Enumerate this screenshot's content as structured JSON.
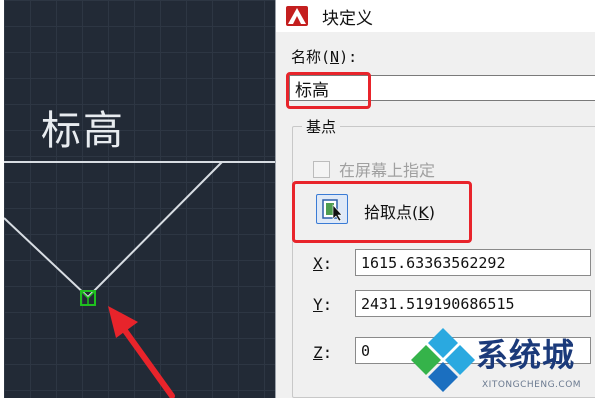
{
  "canvas": {
    "elevation_text": "标高"
  },
  "dialog": {
    "title": "块定义",
    "name_label": "名称(N):",
    "name_value": "标高",
    "base_point": {
      "group_title": "基点",
      "specify_on_screen_label": "在屏幕上指定",
      "specify_on_screen_checked": false,
      "pick_point_label": "拾取点(K)",
      "x_label": "X:",
      "x_value": "1615.63363562292",
      "y_label": "Y:",
      "y_value": "2431.519190686515",
      "z_label": "Z:",
      "z_value": "0"
    }
  },
  "watermark": {
    "text": "系统城",
    "subtext": "XITONGCHENG.COM"
  },
  "colors": {
    "canvas_bg": "#222a36",
    "highlight_red": "#e8242b",
    "cad_green": "#1fc01f",
    "arrow_red": "#e8242b"
  },
  "icons": [
    "autocad-logo-icon",
    "pick-point-icon",
    "base-point-grip-icon",
    "watermark-logo-icon"
  ]
}
